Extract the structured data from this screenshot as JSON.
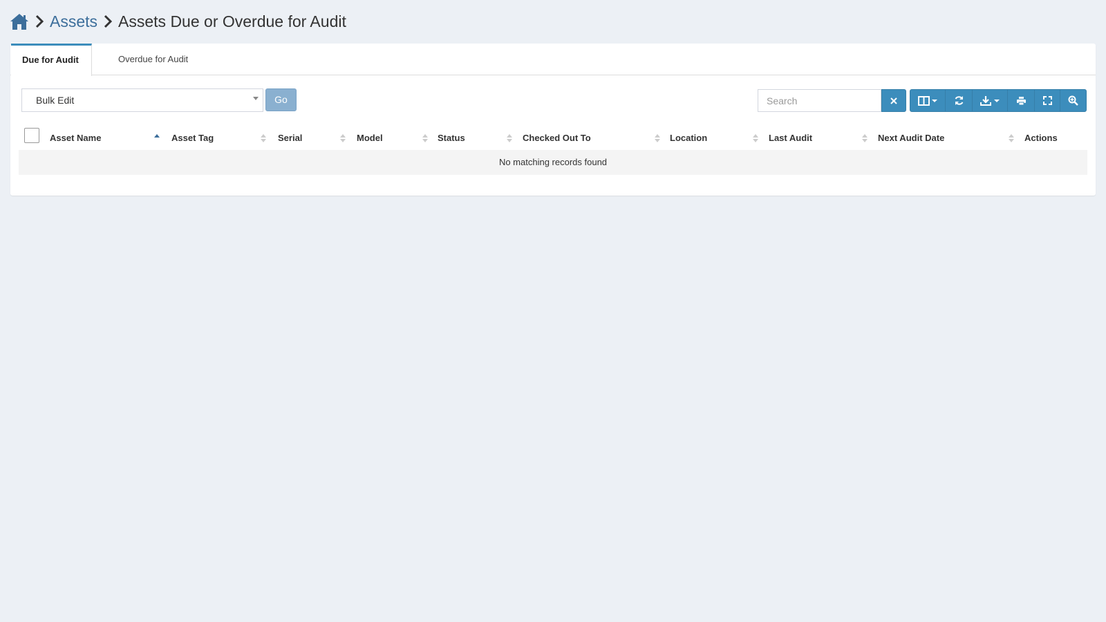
{
  "breadcrumb": {
    "home_icon": "home-icon",
    "separator_icon": "chevron-right-icon",
    "parent": "Assets",
    "current": "Assets Due or Overdue for Audit"
  },
  "tabs": [
    {
      "label": "Due for Audit",
      "active": true
    },
    {
      "label": "Overdue for Audit",
      "active": false
    }
  ],
  "toolbar": {
    "bulk_select_value": "Bulk Edit",
    "go_label": "Go",
    "search_placeholder": "Search",
    "buttons": [
      {
        "name": "clear-search-button",
        "icon": "close-icon"
      },
      {
        "name": "columns-button",
        "icon": "columns-dropdown-icon"
      },
      {
        "name": "refresh-button",
        "icon": "refresh-icon"
      },
      {
        "name": "export-button",
        "icon": "download-dropdown-icon"
      },
      {
        "name": "print-button",
        "icon": "print-icon"
      },
      {
        "name": "fullscreen-button",
        "icon": "fullscreen-icon"
      },
      {
        "name": "advanced-search-button",
        "icon": "zoom-in-icon"
      }
    ]
  },
  "table": {
    "columns": [
      {
        "label": "Asset Name",
        "sort": "asc"
      },
      {
        "label": "Asset Tag",
        "sort": "none"
      },
      {
        "label": "Serial",
        "sort": "none"
      },
      {
        "label": "Model",
        "sort": "none"
      },
      {
        "label": "Status",
        "sort": "none"
      },
      {
        "label": "Checked Out To",
        "sort": "none"
      },
      {
        "label": "Location",
        "sort": "none"
      },
      {
        "label": "Last Audit",
        "sort": "none"
      },
      {
        "label": "Next Audit Date",
        "sort": "none"
      },
      {
        "label": "Actions",
        "sort": "none"
      }
    ],
    "empty_message": "No matching records found"
  },
  "colors": {
    "background": "#ecf0f5",
    "primary": "#3c8dbc",
    "link": "#3c6e9b",
    "go_disabled": "#8ab0d0"
  }
}
